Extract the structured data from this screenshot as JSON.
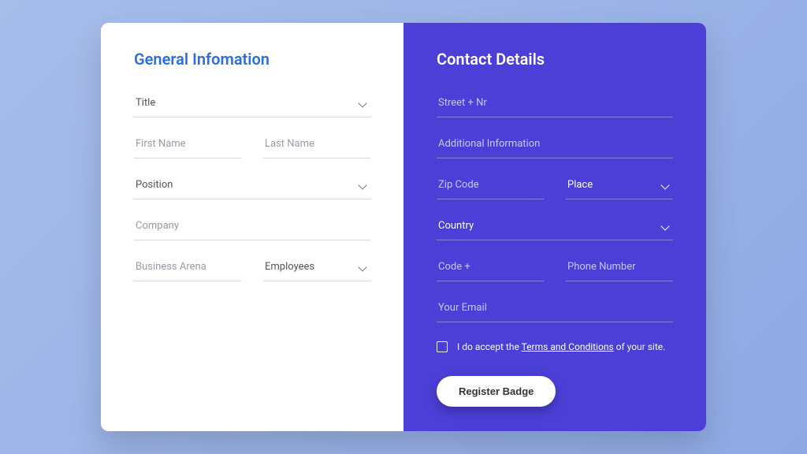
{
  "left": {
    "heading": "General Infomation",
    "title_select": "Title",
    "first_name_ph": "First Name",
    "last_name_ph": "Last Name",
    "position_select": "Position",
    "company_ph": "Company",
    "business_arena_ph": "Business Arena",
    "employees_select": "Employees"
  },
  "right": {
    "heading": "Contact Details",
    "street_ph": "Street + Nr",
    "additional_info_ph": "Additional Information",
    "zip_ph": "Zip Code",
    "place_select": "Place",
    "country_select": "Country",
    "code_ph": "Code +",
    "phone_ph": "Phone Number",
    "email_ph": "Your Email",
    "accept_pre": "I do accept the ",
    "accept_link": "Terms and Conditions",
    "accept_post": " of your site.",
    "submit_label": "Register Badge"
  }
}
